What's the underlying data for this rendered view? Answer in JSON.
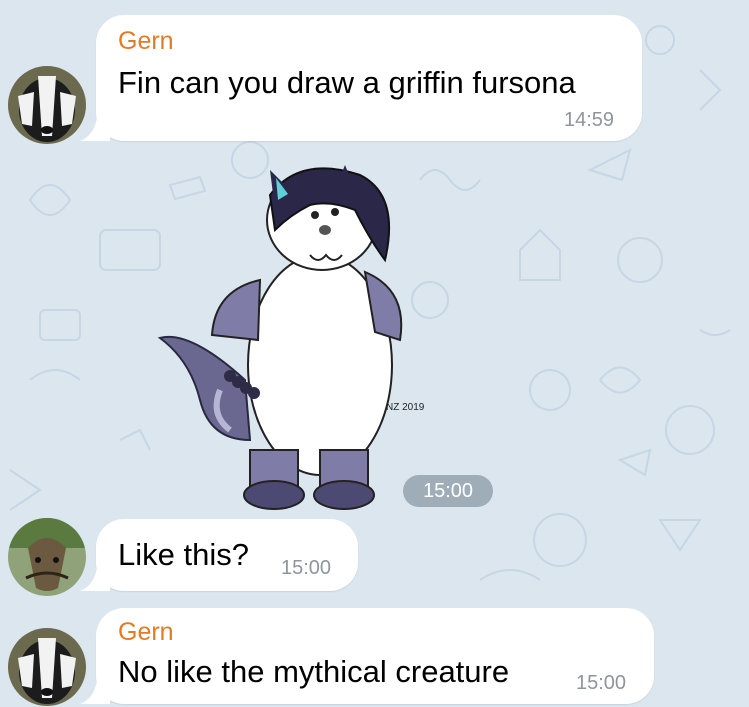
{
  "chat": {
    "messages": [
      {
        "sender": "Gern",
        "text": "Fin can you draw a griffin fursona",
        "time": "14:59",
        "avatar_icon": "badger-avatar-icon"
      },
      {
        "type": "sticker",
        "sticker_icon": "wolf-cat-character-drawing",
        "signature": "NZ 2019",
        "time": "15:00"
      },
      {
        "text": "Like this?",
        "time": "15:00",
        "avatar_icon": "catfish-avatar-icon"
      },
      {
        "sender": "Gern",
        "text": "No like the mythical creature",
        "time": "15:00",
        "avatar_icon": "badger-avatar-icon"
      }
    ]
  },
  "colors": {
    "background": "#dbe6ef",
    "bubble": "#ffffff",
    "sender_name": "#e07b26",
    "timestamp": "#8e959b",
    "time_pill": "#8695a3"
  }
}
